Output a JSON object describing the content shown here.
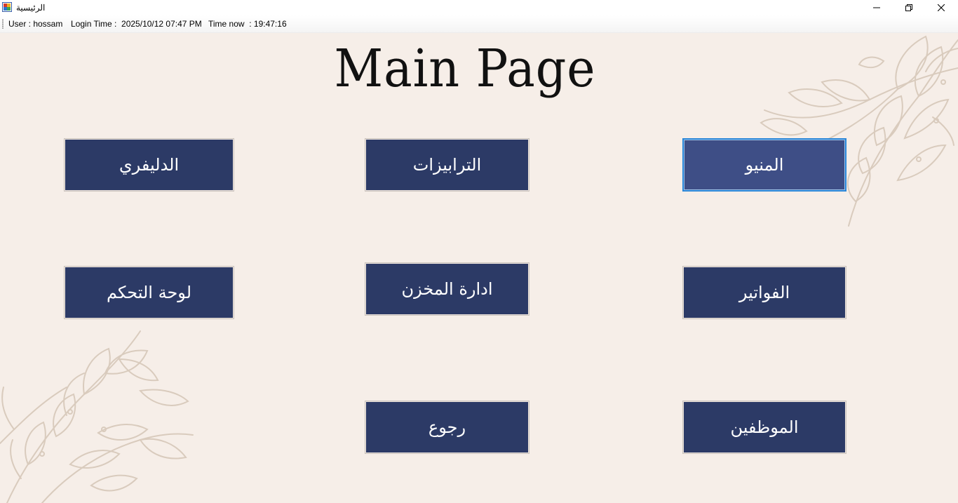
{
  "window": {
    "title": "الرئيسية"
  },
  "status": {
    "user": "User : hossam",
    "login_time": "Login Time :  2025/10/12 07:47 PM",
    "time_now": "Time now  : 19:47:16"
  },
  "page": {
    "title": "Main Page"
  },
  "buttons": {
    "delivery": "الدليفري",
    "tables": "الترابيزات",
    "menu": "المنيو",
    "dashboard": "لوحة التحكم",
    "inventory": "ادارة المخزن",
    "invoices": "الفواتير",
    "back": "رجوع",
    "employees": "الموظفين"
  },
  "colors": {
    "background": "#f6eee8",
    "button": "#2c3a66",
    "button_focused": "#3e4e86",
    "focus_border": "#2a86d8",
    "leaf_outline": "#d9cbbd"
  }
}
